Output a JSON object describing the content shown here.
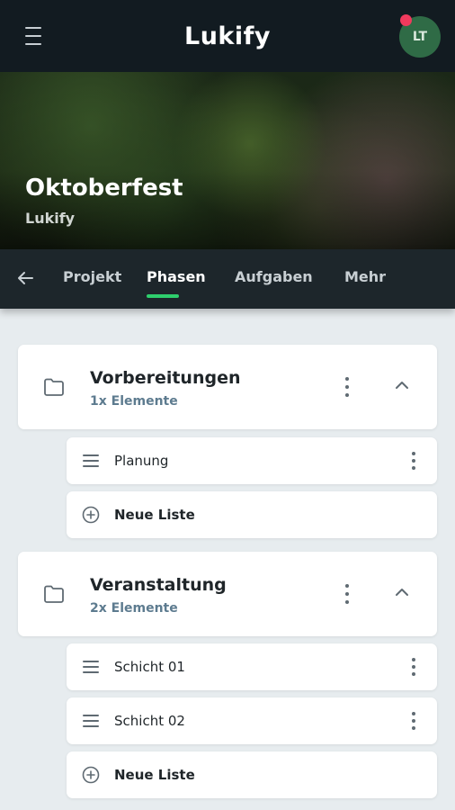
{
  "app": {
    "title": "Lukify",
    "avatar_initials": "LT"
  },
  "project": {
    "title": "Oktoberfest",
    "subtitle": "Lukify"
  },
  "tabs": [
    {
      "label": "Projekt"
    },
    {
      "label": "Phasen",
      "active": true
    },
    {
      "label": "Aufgaben"
    },
    {
      "label": "Mehr"
    }
  ],
  "phases": [
    {
      "title": "Vorbereitungen",
      "count": "1x Elemente",
      "lists": [
        {
          "label": "Planung"
        }
      ],
      "new_list_label": "Neue Liste"
    },
    {
      "title": "Veranstaltung",
      "count": "2x Elemente",
      "lists": [
        {
          "label": "Schicht 01"
        },
        {
          "label": "Schicht 02"
        }
      ],
      "new_list_label": "Neue Liste"
    }
  ],
  "colors": {
    "topbar": "#121b21",
    "accent": "#2ecf6d",
    "notification": "#f03a5d",
    "avatar": "#2f6b46"
  }
}
